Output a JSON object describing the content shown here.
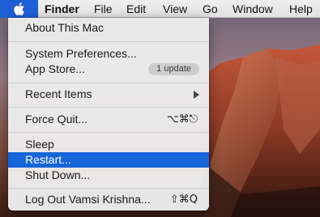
{
  "menubar": {
    "items": [
      "Finder",
      "File",
      "Edit",
      "View",
      "Go",
      "Window",
      "Help"
    ]
  },
  "apple_menu": {
    "about": "About This Mac",
    "system_preferences": "System Preferences...",
    "app_store": "App Store...",
    "app_store_badge": "1 update",
    "recent_items": "Recent Items",
    "force_quit": "Force Quit...",
    "force_quit_shortcut": "⌥⌘⎋",
    "sleep": "Sleep",
    "restart": "Restart...",
    "shut_down": "Shut Down...",
    "log_out": "Log Out Vamsi Krishna...",
    "log_out_shortcut": "⇧⌘Q"
  },
  "colors": {
    "accent": "#1665d8",
    "menubar": "#e8e8e9"
  }
}
